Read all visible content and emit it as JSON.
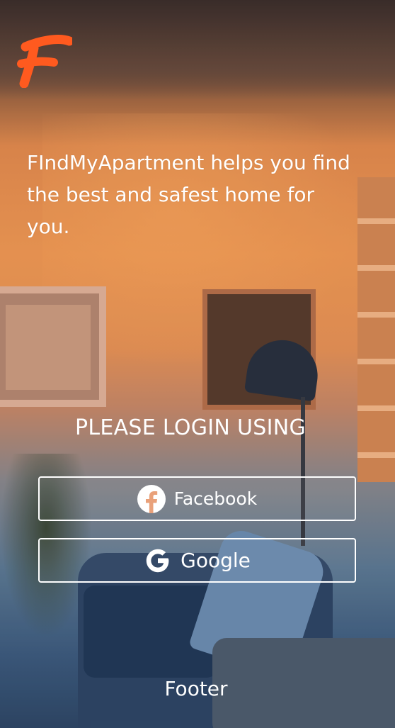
{
  "app": {
    "brand_icon": "findmyapartment-logo-icon",
    "brand_color": "#ff5a1f"
  },
  "hero": {
    "tagline": "FIndMyApartment helps you find the best and safest home for you."
  },
  "login": {
    "heading": "PLEASE LOGIN USING",
    "facebook": {
      "label": "Facebook",
      "icon": "facebook-icon"
    },
    "google": {
      "label": "Google",
      "icon": "google-icon"
    }
  },
  "footer": {
    "text": "Footer"
  }
}
